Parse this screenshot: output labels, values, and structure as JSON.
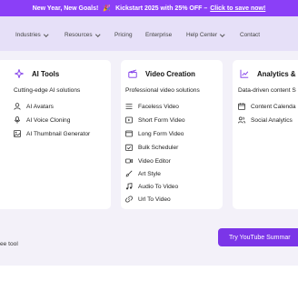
{
  "banner": {
    "headline": "New Year, New Goals!",
    "separator": "🎉",
    "promo": "Kickstart 2025 with 25% OFF –",
    "link": "Click to save now!"
  },
  "nav": {
    "items": [
      {
        "label": "Industries",
        "dropdown": true
      },
      {
        "label": "Resources",
        "dropdown": true
      },
      {
        "label": "Pricing",
        "dropdown": false
      },
      {
        "label": "Enterprise",
        "dropdown": false
      },
      {
        "label": "Help Center",
        "dropdown": true
      },
      {
        "label": "Contact",
        "dropdown": false
      }
    ]
  },
  "menu": {
    "ai_tools": {
      "title": "AI Tools",
      "subtitle": "Cutting-edge AI solutions",
      "items": [
        "AI Avatars",
        "AI Voice Cloning",
        "AI Thumbnail Generator"
      ]
    },
    "video_creation": {
      "title": "Video Creation",
      "subtitle": "Professional video solutions",
      "items": [
        "Faceless Video",
        "Short Form Video",
        "Long Form Video",
        "Bulk Scheduler",
        "Video Editor",
        "Art Style",
        "Audio To Video",
        "Url To Video"
      ]
    },
    "analytics": {
      "title": "Analytics & P",
      "subtitle": "Data-driven content S",
      "items": [
        "Content Calenda",
        "Social Analytics"
      ]
    }
  },
  "footer": {
    "text": "ee tool",
    "cta": "Try YouTube Summar"
  },
  "colors": {
    "accent": "#7b35e8",
    "banner": "#8b3ff7",
    "nav_bg": "#e6e0f8",
    "menu_bg": "#f3f1f9"
  }
}
